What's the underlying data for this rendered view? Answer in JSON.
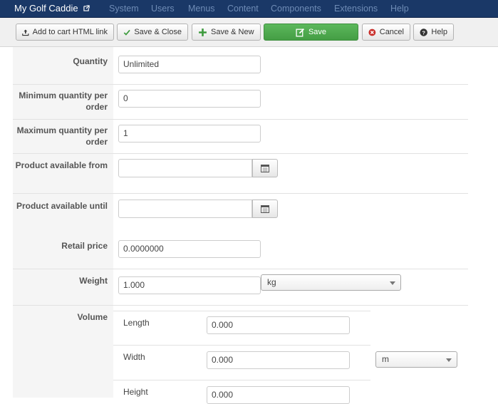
{
  "navbar": {
    "brand": "My Golf Caddie",
    "menu": [
      "System",
      "Users",
      "Menus",
      "Content",
      "Components",
      "Extensions",
      "Help"
    ]
  },
  "toolbar": {
    "add_to_cart": "Add to cart HTML link",
    "save_close": "Save & Close",
    "save_new": "Save & New",
    "save": "Save",
    "cancel": "Cancel",
    "help": "Help"
  },
  "form": {
    "quantity": {
      "label": "Quantity",
      "value": "Unlimited"
    },
    "min_qty": {
      "label": "Minimum quantity per order",
      "value": "0"
    },
    "max_qty": {
      "label": "Maximum quantity per order",
      "value": "1"
    },
    "available_from": {
      "label": "Product available from",
      "value": ""
    },
    "available_until": {
      "label": "Product available until",
      "value": ""
    },
    "retail_price": {
      "label": "Retail price",
      "value": "0.0000000"
    },
    "weight": {
      "label": "Weight",
      "value": "1.000",
      "unit": "kg"
    },
    "volume": {
      "label": "Volume",
      "length_label": "Length",
      "length": "0.000",
      "width_label": "Width",
      "width": "0.000",
      "height_label": "Height",
      "height": "0.000",
      "unit": "m"
    }
  },
  "colors": {
    "navbar": "#1a3867",
    "save_button": "#51a351",
    "label_bg": "#f5f5f5"
  }
}
